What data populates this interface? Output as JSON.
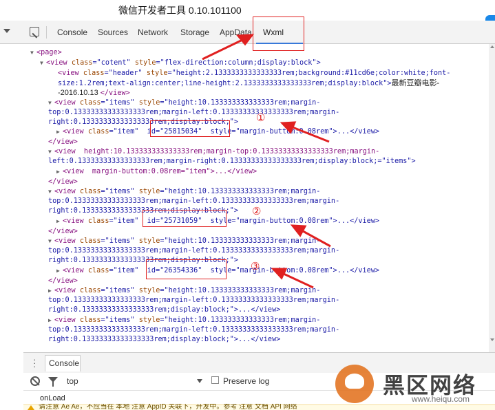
{
  "window": {
    "title": "微信开发者工具 0.10.101100"
  },
  "toolbar": {
    "tabs": [
      {
        "label": "Console"
      },
      {
        "label": "Sources"
      },
      {
        "label": "Network"
      },
      {
        "label": "Storage"
      },
      {
        "label": "AppData"
      },
      {
        "label": "Wxml",
        "active": true
      }
    ]
  },
  "dom": {
    "l1": "<page>",
    "l2a": "<view ",
    "l2b": "class",
    "l2c": "=\"cotent\" ",
    "l2d": "style",
    "l2e": "=\"flex-direction:column;display:block\">",
    "l3a": "<view ",
    "l3b": "class",
    "l3c": "=\"header\" ",
    "l3d": "style",
    "l3e": "=\"height:2.1333333333333333rem;background:#11cd6e;color:white;font-",
    "l4": "size:1.2rem;text-align:center;line-height:2.1333333333333333rem;display:block\">",
    "l4txt": "最新豆瓣电影-",
    "l5a": "-2016.10.13 ",
    "l5b": "</view>",
    "items_style_1": "=\"height:10.133333333333333rem;margin-",
    "items_style_2": "top:0.13333333333333333rem;margin-left:0.13333333333333333rem;margin-",
    "items_style_3": "right:0.13333333333333333rem;display:block;\">",
    "item_row_1": "=\"item\"  id=\"25815034\"  style=\"margin-buttom:0.08rem\">...</view>",
    "close_view": "</view>",
    "alt_1": "<view  height:10.133333333333333rem;margin-top:0.13333333333333333rem;margin-",
    "alt_2": "left:0.13333333333333333rem;margin-right:0.13333333333333333rem;display:block;=\"items\">",
    "alt_row": "<view  margin-buttom:0.08rem=\"item\">...</view>",
    "items_style_3b": "right:0.13333333333333333rem;display:block;\">",
    "item_row_2": "=\"item\"  id=\"25731059\"  style=\"margin-buttom:0.08rem\">...</view>",
    "items_style_3c": "right:0.13333333333333333rem;display:block;\">",
    "item_row_3": "=\"item\"  id=\"26354336\"  style=\"margin-buttom:0.08rem\">...</view>",
    "collapsed_end": "right:0.13333333333333333rem;display:block;\">...</view>"
  },
  "annotations": {
    "n1": "①",
    "n2": "②",
    "n3": "③"
  },
  "drawer": {
    "tab": "Console",
    "context": "top",
    "preserve_log": "Preserve log",
    "log_line": "onLoad",
    "warning": "请注意 Ae Ae，不应当在 本地 注意 AppID 关联下，开发中。参考 注意 文档 API 网络"
  },
  "watermark": {
    "brand": "黑区网络",
    "url": "www.heiqu.com"
  },
  "colors": {
    "accent": "#3879d9",
    "annotation": "#e02020",
    "tag": "#881280",
    "attr": "#994500",
    "value": "#1a1aa6"
  }
}
